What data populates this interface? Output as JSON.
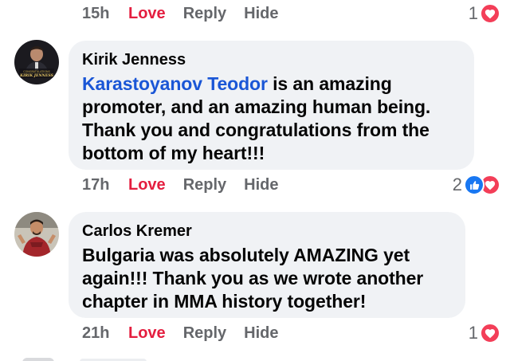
{
  "top_actions": {
    "time": "15h",
    "love": "Love",
    "reply": "Reply",
    "hide": "Hide",
    "reaction_count": "1",
    "reaction_icons": [
      "heart-icon"
    ]
  },
  "comments": [
    {
      "author": "Kirik Jenness",
      "avatar_caption": "CONGRATULATIONS KIRIK JENNESS",
      "mention": "Karastoyanov Teodor",
      "text": " is an amazing promoter, and an amazing human being. Thank you and congratulations from the bottom of my heart!!!",
      "actions": {
        "time": "17h",
        "love": "Love",
        "reply": "Reply",
        "hide": "Hide",
        "reaction_count": "2",
        "reaction_icons": [
          "like-icon",
          "heart-icon"
        ]
      }
    },
    {
      "author": "Carlos Kremer",
      "text": "Bulgaria was absolutely AMAZING yet again!!! Thank you as we wrote another chapter in MMA history together!",
      "actions": {
        "time": "21h",
        "love": "Love",
        "reply": "Reply",
        "hide": "Hide",
        "reaction_count": "1",
        "reaction_icons": [
          "heart-icon"
        ]
      }
    }
  ],
  "colors": {
    "love": "#e41e3f",
    "muted": "#65676b",
    "mention": "#1a56d6",
    "bubble": "#f0f2f5",
    "like": "#1877f2",
    "heart": "#f33e58"
  }
}
